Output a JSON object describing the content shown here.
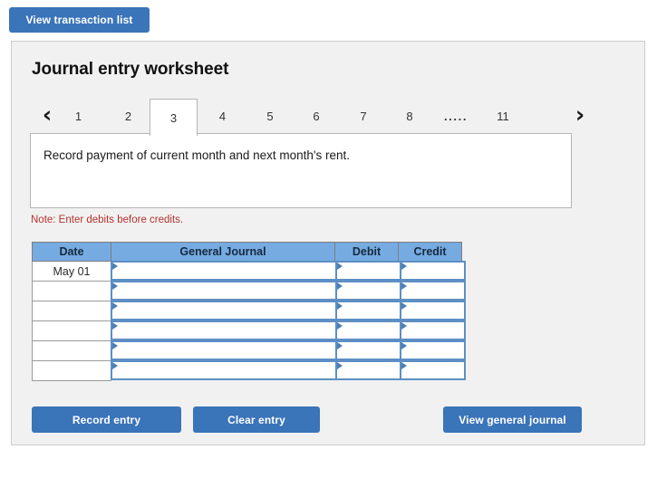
{
  "toolbar": {
    "view_transaction_list_label": "View transaction list"
  },
  "panel": {
    "title": "Journal entry worksheet"
  },
  "pagination": {
    "prev_icon": "chevron-left-icon",
    "next_icon": "chevron-right-icon",
    "prev_glyph": "‹",
    "next_glyph": "›",
    "pages": [
      "1",
      "2",
      "3",
      "4",
      "5",
      "6",
      "7",
      "8"
    ],
    "ellipsis": ".....",
    "last_page": "11",
    "active_page": "3"
  },
  "instruction": {
    "text": "Record payment of current month and next month's rent."
  },
  "note": {
    "text": "Note: Enter debits before credits."
  },
  "journal": {
    "columns": [
      "Date",
      "General Journal",
      "Debit",
      "Credit"
    ],
    "rows": [
      {
        "date": "May 01",
        "general_journal": "",
        "debit": "",
        "credit": ""
      },
      {
        "date": "",
        "general_journal": "",
        "debit": "",
        "credit": ""
      },
      {
        "date": "",
        "general_journal": "",
        "debit": "",
        "credit": ""
      },
      {
        "date": "",
        "general_journal": "",
        "debit": "",
        "credit": ""
      },
      {
        "date": "",
        "general_journal": "",
        "debit": "",
        "credit": ""
      },
      {
        "date": "",
        "general_journal": "",
        "debit": "",
        "credit": ""
      }
    ]
  },
  "actions": {
    "record_entry_label": "Record entry",
    "clear_entry_label": "Clear entry",
    "view_general_journal_label": "View general journal"
  },
  "colors": {
    "button_blue": "#3a74b9",
    "table_header_blue": "#76abe2",
    "input_border_blue": "#5d8fc4",
    "note_red": "#b3322c",
    "panel_bg": "#f1f1f1"
  }
}
